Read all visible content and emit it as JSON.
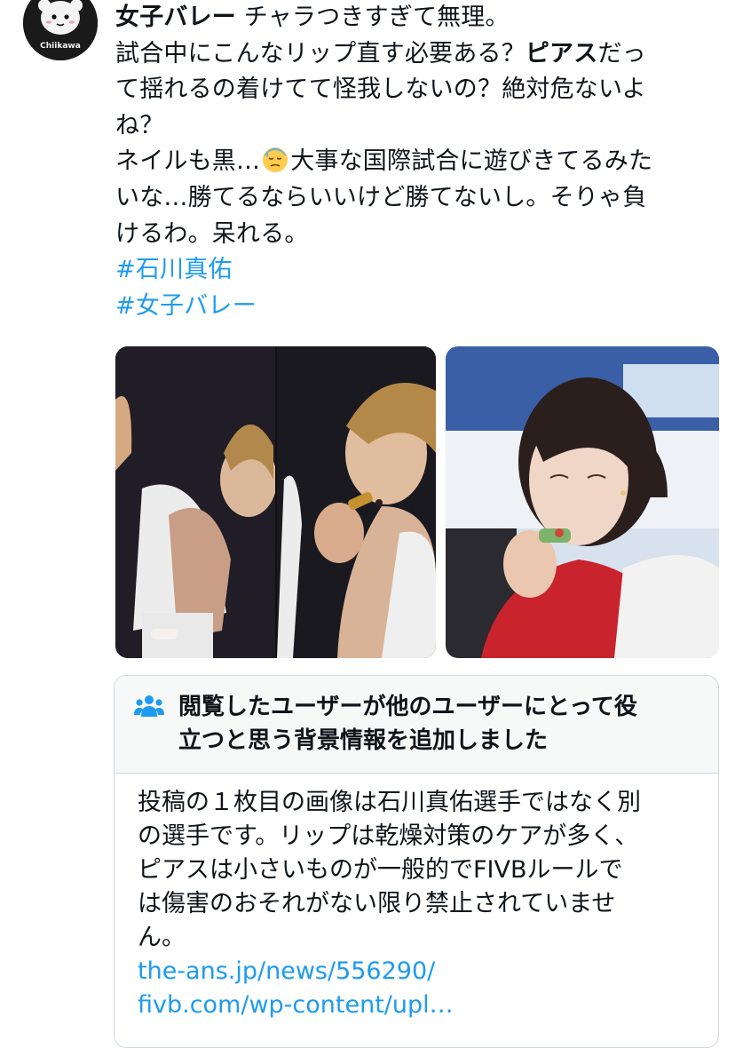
{
  "avatar": {
    "text": "Chiikawa"
  },
  "tweet": {
    "lines": [
      {
        "bold": "女子バレー",
        "rest": " チャラつきすぎて無理。"
      },
      {
        "pre": "試合中にこんなリップ直す必要ある？",
        "bold": "ピアス",
        "post": "だっ"
      },
      {
        "text": "て揺れるの着けてて怪我しないの？絶対危ないよ"
      },
      {
        "text": "ね？"
      },
      {
        "pre": "ネイルも黒…",
        "emoji": "downcast-face-with-sweat-icon",
        "post": "大事な国際試合に遊びきてるみた"
      },
      {
        "text": "いな…勝てるならいいけど勝てないし。そりゃ負"
      },
      {
        "text": "けるわ。呆れる。"
      }
    ],
    "hashtags": [
      "#石川真佑",
      "#女子バレー"
    ]
  },
  "media": {
    "photos": [
      {
        "description": "collage-two-frames"
      },
      {
        "description": "player-applying-lip"
      }
    ]
  },
  "community_note": {
    "icon": "people-icon",
    "title_lines": [
      "閲覧したユーザーが他のユーザーにとって役",
      "立つと思う背景情報を追加しました"
    ],
    "body_lines": [
      "投稿の１枚目の画像は石川真佑選手ではなく別",
      "の選手です。リップは乾燥対策のケアが多く、",
      "ピアスは小さいものが一般的でFIVBルールで",
      "は傷害のおそれがない限り禁止されていませ",
      "ん。"
    ],
    "links": [
      "the-ans.jp/news/556290/",
      "fivb.com/wp-content/upl…"
    ]
  },
  "colors": {
    "link": "#1d9bf0",
    "text": "#0f1419",
    "border": "#cfd9de",
    "note_header_bg": "#f7f9f9"
  }
}
